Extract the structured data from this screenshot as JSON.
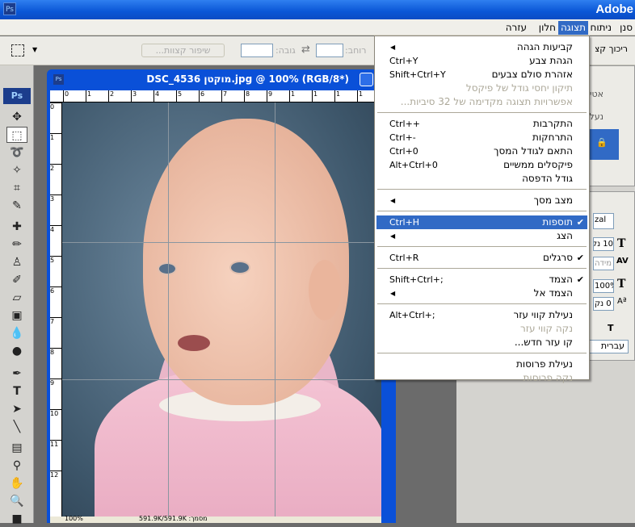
{
  "app": {
    "title": "Adobe",
    "logo": "Ps"
  },
  "menubar": [
    {
      "label": "סנן"
    },
    {
      "label": "ניתוח"
    },
    {
      "label": "תצוגה",
      "active": true
    },
    {
      "label": "חלון"
    },
    {
      "label": "עזרה"
    }
  ],
  "options": {
    "refine_edge": "שיפור קצוות...",
    "height_label": "גובה:",
    "width_label": "רוחב:",
    "clear_label": "ריכוך קצ"
  },
  "document": {
    "title": "DSC_4536 מוקטן.jpg @ 100% (RGB/8*)",
    "zoom": "100%",
    "status": "מסמך: 591.9K/591.9K",
    "ruler_top": [
      "0",
      "1",
      "2",
      "3",
      "4",
      "5",
      "6",
      "7",
      "8",
      "9",
      "1",
      "1",
      "1",
      "1"
    ],
    "ruler_left": [
      "0",
      "1",
      "2",
      "3",
      "4",
      "5",
      "6",
      "7",
      "8",
      "9",
      "10",
      "11",
      "12"
    ]
  },
  "view_menu": {
    "items": [
      {
        "label": "קביעות הגהה",
        "submenu": true
      },
      {
        "label": "הגהת צבע",
        "shortcut": "Ctrl+Y"
      },
      {
        "label": "אזהרת סולם צבעים",
        "shortcut": "Shift+Ctrl+Y"
      },
      {
        "label": "תיקון יחסי גודל של פיקסל",
        "disabled": true
      },
      {
        "label": "אפשרויות תצוגה מקדימה של 32 סיביות...",
        "disabled": true
      },
      {
        "sep": true
      },
      {
        "label": "התקרבות",
        "shortcut": "Ctrl++"
      },
      {
        "label": "התרחקות",
        "shortcut": "Ctrl+-"
      },
      {
        "label": "התאם לגודל המסך",
        "shortcut": "Ctrl+0"
      },
      {
        "label": "פיקסלים ממשיים",
        "shortcut": "Alt+Ctrl+0"
      },
      {
        "label": "גודל הדפסה"
      },
      {
        "sep": true
      },
      {
        "label": "מצב מסך",
        "submenu": true
      },
      {
        "sep": true
      },
      {
        "label": "תוספות",
        "shortcut": "Ctrl+H",
        "checked": true,
        "highlighted": true
      },
      {
        "label": "הצג",
        "submenu": true
      },
      {
        "sep": true
      },
      {
        "label": "סרגלים",
        "shortcut": "Ctrl+R",
        "checked": true
      },
      {
        "sep": true
      },
      {
        "label": "הצמד",
        "shortcut": "Shift+Ctrl+;",
        "checked": true
      },
      {
        "label": "הצמד אל",
        "submenu": true
      },
      {
        "sep": true
      },
      {
        "label": "נעילת קווי עזר",
        "shortcut": "Alt+Ctrl+;"
      },
      {
        "label": "נקה קווי עזר",
        "disabled": true
      },
      {
        "label": "קו עזר חדש..."
      },
      {
        "sep": true
      },
      {
        "label": "נעילת פרוסות"
      },
      {
        "label": "נקה פרוסות",
        "disabled": true
      }
    ]
  },
  "panels": {
    "opacity_label": "אטימות:",
    "lock_label": "נעל:",
    "font_value": "zal",
    "size_value": "10 נק",
    "tracking_value": "מידה",
    "scale_value": "100%",
    "baseline_value": "0 נק",
    "language": "עברית"
  },
  "colors": {
    "accent": "#316ac5",
    "title": "#0a56d6"
  }
}
